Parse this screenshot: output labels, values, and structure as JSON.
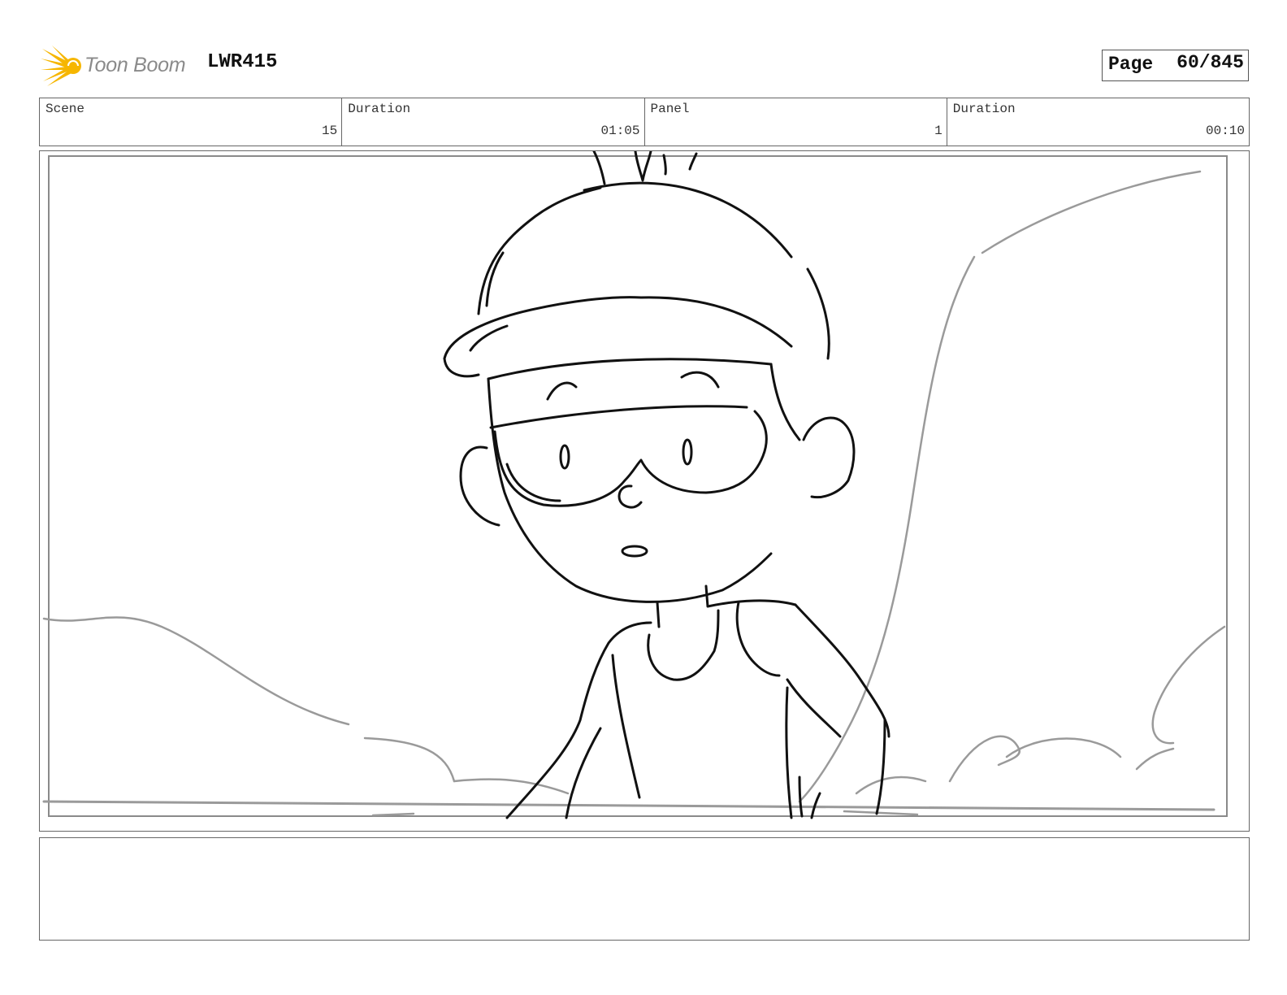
{
  "header": {
    "logo_text": "Toon Boom",
    "project_code": "LWR415",
    "page_label": "Page",
    "page_value": "60/845"
  },
  "info": [
    {
      "label": "Scene",
      "value": "15"
    },
    {
      "label": "Duration",
      "value": "01:05"
    },
    {
      "label": "Panel",
      "value": "1"
    },
    {
      "label": "Duration",
      "value": "00:10"
    }
  ],
  "panel": {
    "sketch_icon": "storyboard-sketch-character-with-goggles",
    "line_color": "#111111",
    "background_line_color": "#9a9a9a"
  },
  "notes": {
    "text": ""
  },
  "colors": {
    "logo_accent": "#f6b600",
    "logo_text": "#8a8a8a",
    "border": "#666666"
  }
}
